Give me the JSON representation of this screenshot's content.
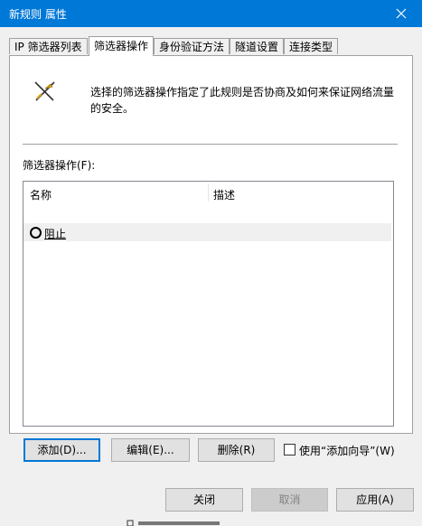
{
  "window": {
    "title": "新规则 属性"
  },
  "tabs": [
    {
      "label": "IP 筛选器列表"
    },
    {
      "label": "筛选器操作"
    },
    {
      "label": "身份验证方法"
    },
    {
      "label": "隧道设置"
    },
    {
      "label": "连接类型"
    }
  ],
  "panel": {
    "description": "选择的筛选器操作指定了此规则是否协商及如何来保证网络流量的安全。",
    "filter_action_label": "筛选器操作(F):",
    "list": {
      "columns": [
        "名称",
        "描述"
      ],
      "rows": [
        {
          "name": "阻止",
          "description": ""
        }
      ]
    },
    "buttons": {
      "add": "添加(D)...",
      "edit": "编辑(E)...",
      "remove": "删除(R)"
    },
    "wizard_checkbox": {
      "label": "使用“添加向导”(W)",
      "checked": false
    }
  },
  "footer": {
    "close": "关闭",
    "cancel": "取消",
    "apply": "应用(A)"
  },
  "colors": {
    "titlebar": "#0078d7",
    "focus": "#0078d7"
  }
}
